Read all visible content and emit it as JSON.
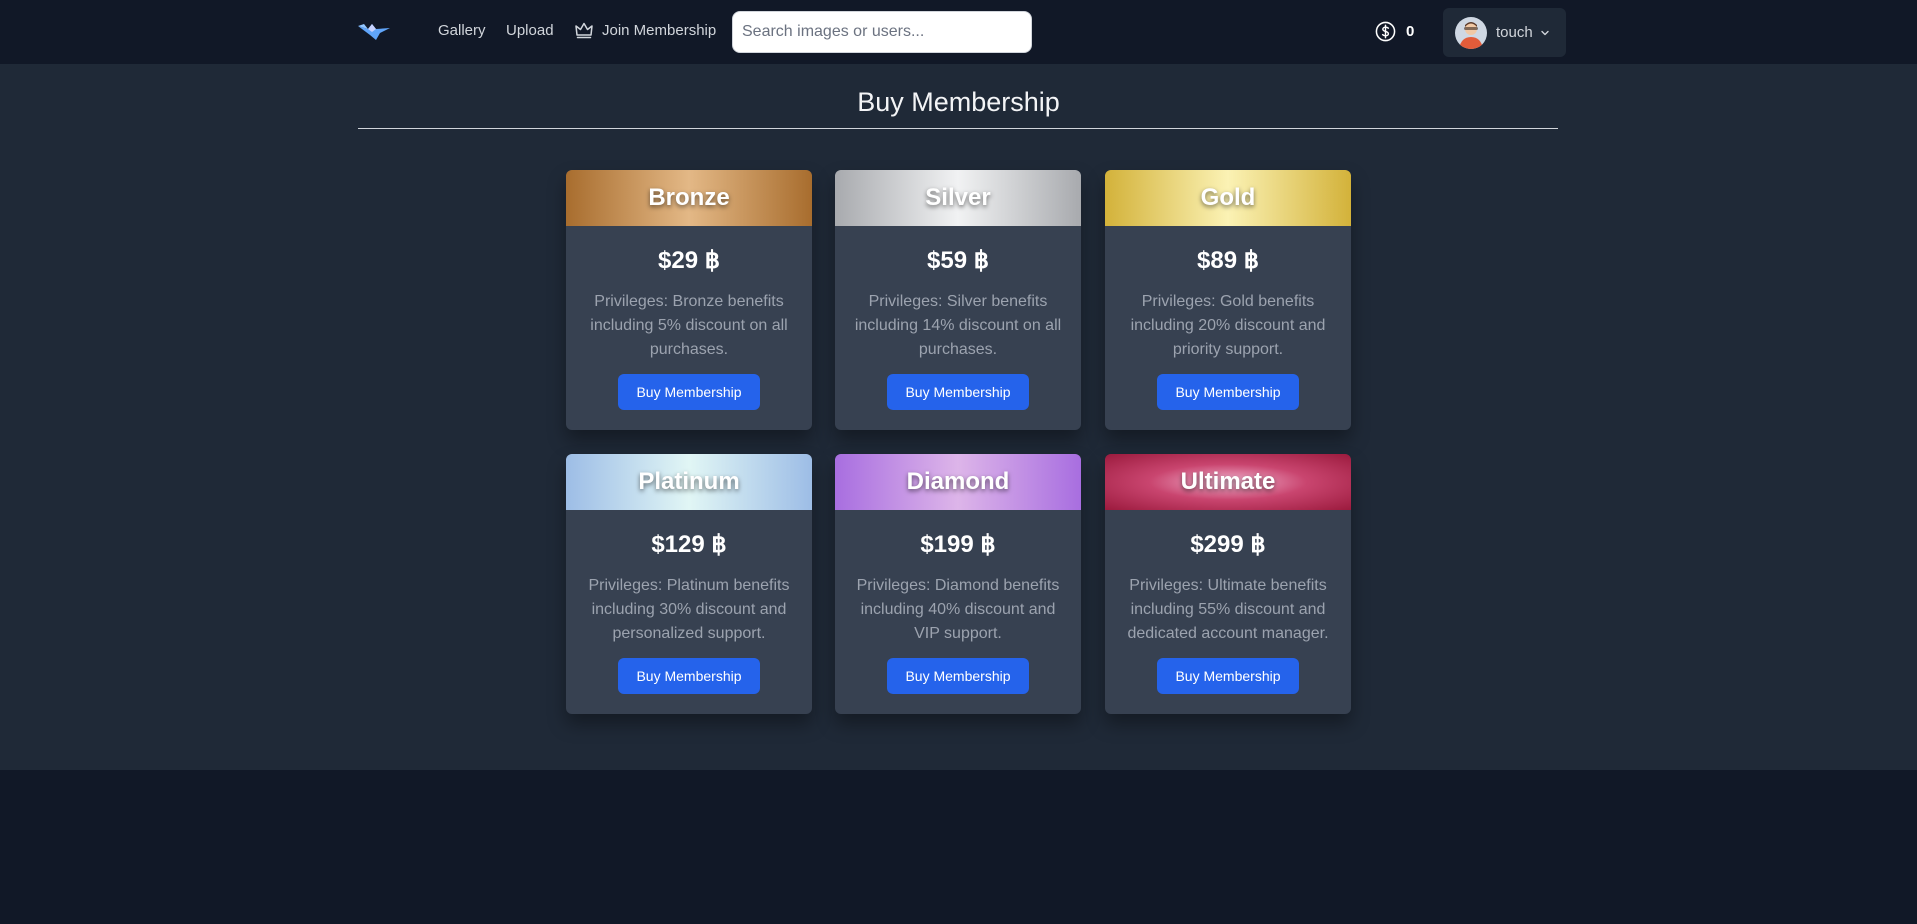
{
  "nav": {
    "links": [
      {
        "label": "Gallery"
      },
      {
        "label": "Upload"
      },
      {
        "label": "Join Membership"
      }
    ]
  },
  "search": {
    "placeholder": "Search images or users...",
    "value": ""
  },
  "wallet": {
    "count": "0"
  },
  "user": {
    "name": "touch"
  },
  "page": {
    "title": "Buy Membership"
  },
  "plans": [
    {
      "name": "Bronze",
      "price": "$29 ฿",
      "description": "Privileges: Bronze benefits including 5% discount on all purchases.",
      "button": "Buy Membership"
    },
    {
      "name": "Silver",
      "price": "$59 ฿",
      "description": "Privileges: Silver benefits including 14% discount on all purchases.",
      "button": "Buy Membership"
    },
    {
      "name": "Gold",
      "price": "$89 ฿",
      "description": "Privileges: Gold benefits including 20% discount and priority support.",
      "button": "Buy Membership"
    },
    {
      "name": "Platinum",
      "price": "$129 ฿",
      "description": "Privileges: Platinum benefits including 30% discount and personalized support.",
      "button": "Buy Membership"
    },
    {
      "name": "Diamond",
      "price": "$199 ฿",
      "description": "Privileges: Diamond benefits including 40% discount and VIP support.",
      "button": "Buy Membership"
    },
    {
      "name": "Ultimate",
      "price": "$299 ฿",
      "description": "Privileges: Ultimate benefits including 55% discount and dedicated account manager.",
      "button": "Buy Membership"
    }
  ],
  "colors": {
    "navbar_bg": "#111827",
    "main_bg": "#1f2937",
    "card_bg": "#374151",
    "button_bg": "#2563eb",
    "bronze": "#a86d2e",
    "silver": "#a8aaae",
    "gold": "#d3b23a",
    "platinum": "#9dbde6",
    "diamond": "#a86ee0",
    "ultimate": "#9b1a3d"
  }
}
